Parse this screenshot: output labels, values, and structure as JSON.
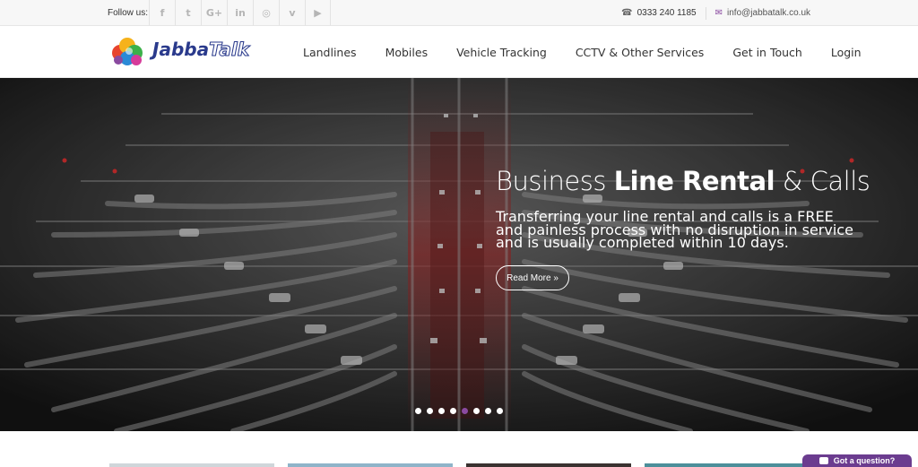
{
  "topbar": {
    "follow_label": "Follow us:",
    "socials": [
      {
        "icon": "facebook-icon",
        "glyph": "f"
      },
      {
        "icon": "twitter-icon",
        "glyph": "t"
      },
      {
        "icon": "google-plus-icon",
        "glyph": "G+"
      },
      {
        "icon": "linkedin-icon",
        "glyph": "in"
      },
      {
        "icon": "instagram-icon",
        "glyph": "◎"
      },
      {
        "icon": "vimeo-icon",
        "glyph": "v"
      },
      {
        "icon": "youtube-icon",
        "glyph": "▶"
      }
    ],
    "phone": "0333 240 1185",
    "email": "info@jabbatalk.co.uk"
  },
  "brand": {
    "name_part1": "Jabba",
    "name_part2": "Talk",
    "primary_color": "#2a3a8c",
    "accent_color": "#6b3c8f"
  },
  "nav": {
    "items": [
      "Landlines",
      "Mobiles",
      "Vehicle Tracking",
      "CCTV & Other Services",
      "Get in Touch",
      "Login"
    ]
  },
  "hero": {
    "title_light1": "Business ",
    "title_bold": "Line Rental",
    "title_light2": " & Calls",
    "text": "Transferring your line rental and calls is a FREE and painless process with no disruption in service and is usually completed within 10 days.",
    "button_label": "Read More »",
    "slides_total": 8,
    "active_slide": 5
  },
  "chat": {
    "label": "Got a question?"
  }
}
